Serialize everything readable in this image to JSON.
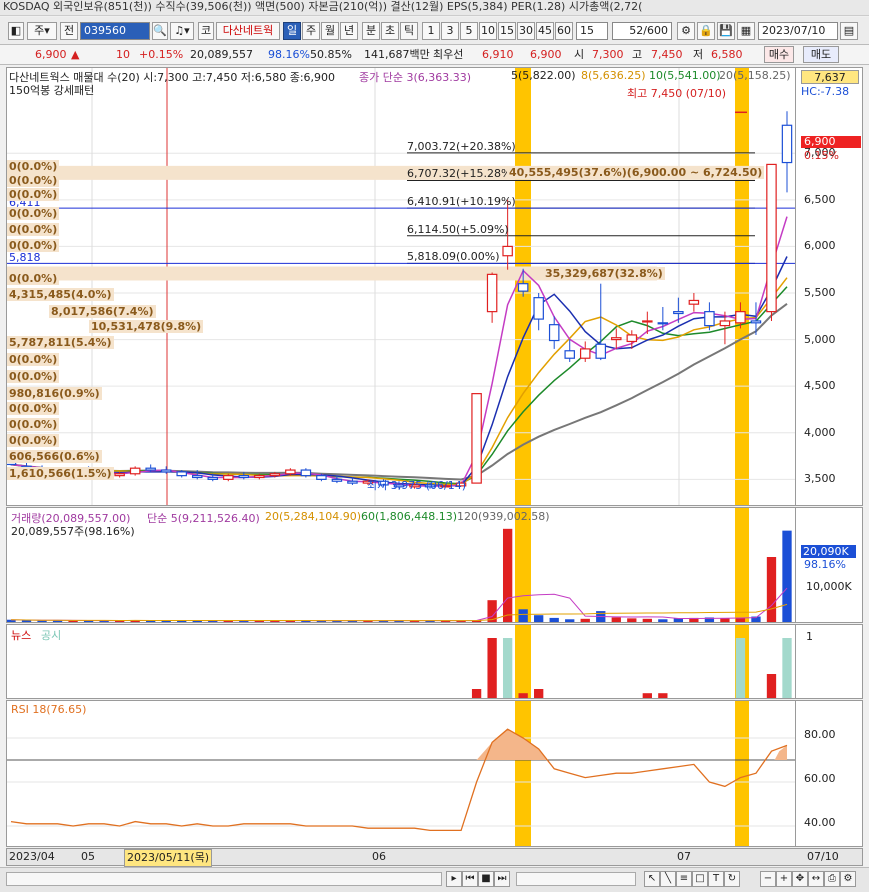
{
  "header": {
    "text": "KOSDAQ 외국인보유(851(천)) 수직수(39,506(천)) 액면(500) 자본금(210(억)) 결산(12월) EPS(5,384) PER(1.28) 시가총액(2,72("
  },
  "toolbar": {
    "mode_label": "주",
    "prev_label": "전",
    "code_value": "039560",
    "icon_name": "speaker-icon",
    "kor_label": "코",
    "stock_name": "다산네트웍",
    "periods": [
      "일",
      "주",
      "월",
      "년",
      "분",
      "초",
      "틱"
    ],
    "minutes": [
      "1",
      "3",
      "5",
      "10",
      "15",
      "30",
      "45",
      "60"
    ],
    "minute_input": "15",
    "count": "52",
    "count_total": "/600",
    "date": "2023/07/10"
  },
  "quote": {
    "price": "6,900",
    "arrow": "▲",
    "change": "10",
    "change_pct": "+0.15%",
    "volume": "20,089,557",
    "vol_pct": "98.16%",
    "ratio": "50.85%",
    "amount": "141,687백만",
    "bid_label": "최우선",
    "bid1": "6,910",
    "bid2": "6,900",
    "open_label": "시",
    "open": "7,300",
    "high_label": "고",
    "high": "7,450",
    "low_label": "저",
    "low": "6,580",
    "buy": "매수",
    "sell": "매도"
  },
  "price_pane": {
    "title": "다산네트웍스 매물대 수(20)  시:7,300 고:7,450 저:6,580 종:6,900",
    "ma_title": "종가 단순 3(6,363.33)",
    "ma5": "5(5,822.00)",
    "ma8": "8(5,636.25)",
    "ma10": "10(5,541.00)",
    "ma20": "20(5,158.25)",
    "subtitle": "150억봉 강세패턴",
    "last_price_box": "7,637",
    "hc_label": "HC:-7.38",
    "max_label": "최고 7,450 (07/10)",
    "min_label": "최저 3,975 (06/14)",
    "current_tag": "6,900",
    "current_pct": "0.15%",
    "levels": [
      {
        "label": "7,003.72(+20.38%)",
        "price": 7003.72
      },
      {
        "label": "6,707.32(+15.28%)",
        "price": 6707.32
      },
      {
        "label": "6,410.91(+10.19%)",
        "price": 6410.91
      },
      {
        "label": "6,114.50(+5.09%)",
        "price": 6114.5
      },
      {
        "label": "5,818.09(0.00%)",
        "price": 5818.09
      }
    ],
    "vp_big": "40,555,495(37.6%)(6,900.00 ~ 6,724.50)",
    "vp_second": "35,329,687(32.8%)",
    "left_levels": [
      "6,411",
      "5,818"
    ],
    "volume_profile": [
      {
        "label": "0(0.0%)",
        "price": 6850
      },
      {
        "label": "0(0.0%)",
        "price": 6700
      },
      {
        "label": "0(0.0%)",
        "price": 6550
      },
      {
        "label": "0(0.0%)",
        "price": 6350
      },
      {
        "label": "0(0.0%)",
        "price": 6180
      },
      {
        "label": "0(0.0%)",
        "price": 6000
      },
      {
        "label": "0(0.0%)",
        "price": 5650
      },
      {
        "label": "4,315,485(4.0%)",
        "price": 5480
      },
      {
        "label": "8,017,586(7.4%)",
        "price": 5300
      },
      {
        "label": "10,531,478(9.8%)",
        "price": 5130
      },
      {
        "label": "5,787,811(5.4%)",
        "price": 4960
      },
      {
        "label": "0(0.0%)",
        "price": 4780
      },
      {
        "label": "0(0.0%)",
        "price": 4600
      },
      {
        "label": "980,816(0.9%)",
        "price": 4420
      },
      {
        "label": "0(0.0%)",
        "price": 4250
      },
      {
        "label": "0(0.0%)",
        "price": 4080
      },
      {
        "label": "0(0.0%)",
        "price": 3910
      },
      {
        "label": "606,566(0.6%)",
        "price": 3740
      },
      {
        "label": "1,610,566(1.5%)",
        "price": 3560
      }
    ],
    "yticks": [
      "7,000",
      "6,500",
      "6,000",
      "5,500",
      "5,000",
      "4,500",
      "4,000",
      "3,500"
    ]
  },
  "volume_pane": {
    "title": "거래량(20,089,557.00)",
    "ma5": "단순 5(9,211,526.40)",
    "ma20": "20(5,284,104.90)",
    "ma60": "60(1,806,448.13)",
    "ma120": "120(939,002.58)",
    "sub": "20,089,557주(98.16%)",
    "tag": "20,090K",
    "tag_pct": "98.16%",
    "ytick": "10,000K"
  },
  "news_pane": {
    "news_label": "뉴스",
    "disc_label": "공시",
    "ytick": "1"
  },
  "rsi_pane": {
    "title": "RSI 18(76.65)",
    "yticks": [
      "80.00",
      "60.00",
      "40.00"
    ]
  },
  "dates": {
    "d1": "2023/04",
    "d2": "05",
    "d3": "2023/05/11(목)",
    "d4": "06",
    "d5": "07",
    "d6": "07/10"
  },
  "chart_data": {
    "type": "candlestick",
    "price_range": [
      3300,
      7700
    ],
    "candles": [
      [
        3780,
        3800,
        3650,
        3660
      ],
      [
        3640,
        3700,
        3590,
        3620
      ],
      [
        3600,
        3650,
        3560,
        3590
      ],
      [
        3580,
        3620,
        3540,
        3570
      ],
      [
        3570,
        3620,
        3550,
        3600
      ],
      [
        3600,
        3640,
        3560,
        3580
      ],
      [
        3560,
        3600,
        3520,
        3540
      ],
      [
        3540,
        3580,
        3520,
        3560
      ],
      [
        3560,
        3640,
        3540,
        3620
      ],
      [
        3620,
        3660,
        3580,
        3600
      ],
      [
        3600,
        3640,
        3560,
        3580
      ],
      [
        3580,
        3600,
        3520,
        3540
      ],
      [
        3540,
        3600,
        3500,
        3520
      ],
      [
        3520,
        3560,
        3480,
        3500
      ],
      [
        3500,
        3560,
        3480,
        3540
      ],
      [
        3540,
        3580,
        3500,
        3520
      ],
      [
        3520,
        3560,
        3500,
        3540
      ],
      [
        3540,
        3580,
        3520,
        3560
      ],
      [
        3560,
        3620,
        3540,
        3600
      ],
      [
        3600,
        3620,
        3520,
        3540
      ],
      [
        3540,
        3560,
        3480,
        3500
      ],
      [
        3500,
        3540,
        3460,
        3480
      ],
      [
        3480,
        3520,
        3440,
        3460
      ],
      [
        3460,
        3500,
        3440,
        3480
      ],
      [
        3480,
        3500,
        3420,
        3440
      ],
      [
        3440,
        3480,
        3400,
        3420
      ],
      [
        3420,
        3460,
        3400,
        3440
      ],
      [
        3440,
        3470,
        3400,
        3420
      ],
      [
        3420,
        3450,
        3975,
        3430
      ],
      [
        3430,
        3480,
        3975,
        3460
      ],
      [
        3460,
        3520,
        4200,
        4420
      ],
      [
        5300,
        5720,
        5180,
        5700
      ],
      [
        5900,
        6500,
        5750,
        6000
      ],
      [
        5600,
        5760,
        5460,
        5520
      ],
      [
        5450,
        5500,
        5100,
        5220
      ],
      [
        5160,
        5250,
        4900,
        4990
      ],
      [
        4880,
        5000,
        4760,
        4800
      ],
      [
        4800,
        4980,
        4760,
        4900
      ],
      [
        4950,
        5600,
        4780,
        4800
      ],
      [
        5000,
        5120,
        4900,
        5020
      ],
      [
        4980,
        5100,
        4900,
        5050
      ],
      [
        5200,
        5300,
        5060,
        5200
      ],
      [
        5180,
        5350,
        5100,
        5170
      ],
      [
        5300,
        5450,
        5180,
        5280
      ],
      [
        5380,
        5500,
        5300,
        5420
      ],
      [
        5300,
        5400,
        5100,
        5150
      ],
      [
        5150,
        5300,
        4950,
        5200
      ],
      [
        5180,
        5400,
        5120,
        5300
      ],
      [
        5200,
        5400,
        5050,
        5180
      ],
      [
        5300,
        6400,
        5200,
        6880
      ],
      [
        7300,
        7450,
        6580,
        6900
      ]
    ],
    "volume": [
      0.5,
      0.4,
      0.3,
      0.3,
      0.3,
      0.3,
      0.3,
      0.3,
      0.4,
      0.3,
      0.3,
      0.3,
      0.3,
      0.3,
      0.3,
      0.3,
      0.3,
      0.3,
      0.3,
      0.3,
      0.3,
      0.3,
      0.3,
      0.3,
      0.3,
      0.3,
      0.3,
      0.3,
      0.3,
      0.3,
      0.4,
      4.8,
      20.5,
      2.8,
      1.5,
      0.9,
      0.6,
      0.7,
      2.4,
      1.0,
      0.8,
      0.7,
      0.6,
      0.8,
      0.9,
      1.0,
      0.8,
      0.9,
      1.2,
      14.3,
      20.1
    ],
    "rsi": [
      42,
      41,
      41,
      41,
      40,
      41,
      41,
      40,
      42,
      41,
      41,
      40,
      41,
      40,
      40,
      41,
      41,
      41,
      41,
      40,
      40,
      40,
      40,
      39,
      39,
      39,
      39,
      38,
      38,
      38,
      60,
      78,
      84,
      80,
      75,
      66,
      64,
      62,
      63,
      64,
      64,
      65,
      66,
      67,
      68,
      60,
      58,
      62,
      64,
      74,
      76.65
    ]
  }
}
